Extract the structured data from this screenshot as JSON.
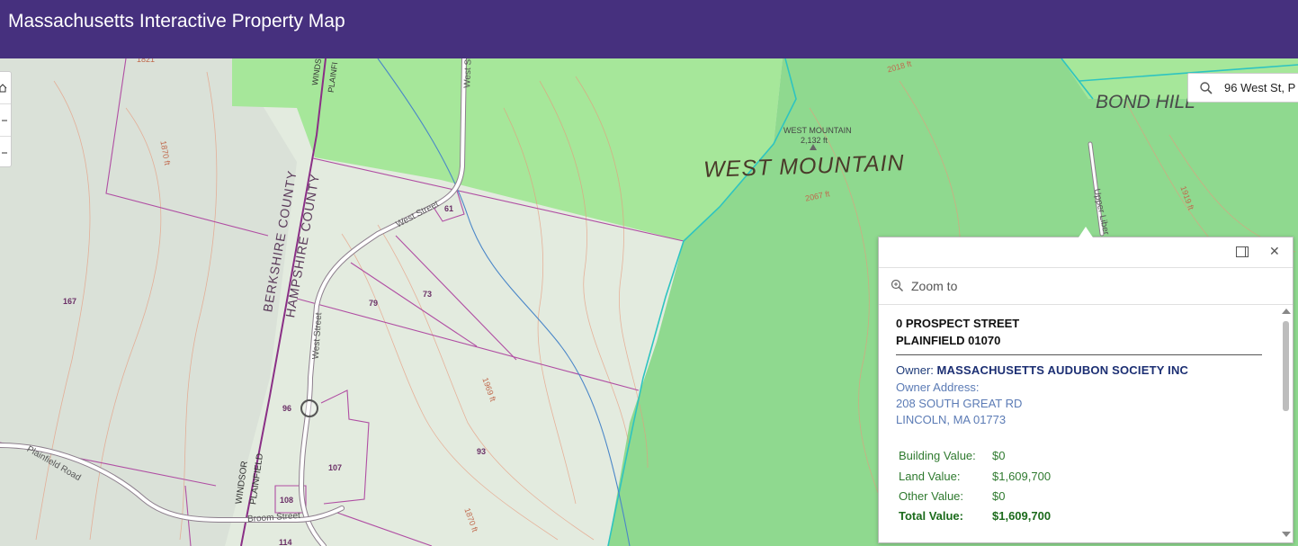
{
  "header": {
    "title": "Massachusetts Interactive Property Map"
  },
  "search": {
    "value": "96 West St, P"
  },
  "colors": {
    "header": "#46307e",
    "forest": "#8fd98f",
    "parcel_line": "#b04ea3",
    "town_line": "#2ec4c0"
  },
  "map_labels": {
    "west_mountain": "WEST MOUNTAIN",
    "bond_hill": "BOND HILL",
    "summit_name": "WEST MOUNTAIN",
    "summit_elev": "2,132 ft",
    "berkshire": "BERKSHIRE COUNTY",
    "hampshire": "HAMPSHIRE COUNTY",
    "windsor_top": "WINDS",
    "plainfield_top": "PLAINFI",
    "windsor_bottom": "WINDSOR",
    "plainfield_bottom": "PLAINFIELD",
    "west_street_1": "West Street",
    "west_street_2": "West Street",
    "west_street_top": "West St",
    "plainfield_road": "Plainfield Road",
    "broom_street": "Broom Street",
    "upper_liberty": "Upper Liber",
    "elev_2018": "2018 ft",
    "elev_2067": "2067 ft",
    "elev_1969": "1969 ft",
    "elev_1870": "1870 ft",
    "elev_1919": "1919 ft",
    "elev_1870b": "1870 ft",
    "elev_1821": "1821"
  },
  "parcels": [
    "167",
    "61",
    "79",
    "73",
    "96",
    "107",
    "93",
    "108",
    "114"
  ],
  "popup": {
    "zoom_to": "Zoom to",
    "address_line1": "0 PROSPECT STREET",
    "address_line2": "PLAINFIELD 01070",
    "owner_label": "Owner:",
    "owner_name": "MASSACHUSETTS AUDUBON SOCIETY INC",
    "owner_address_label": "Owner Address:",
    "owner_address_1": "208 SOUTH GREAT RD",
    "owner_address_2": "LINCOLN, MA 01773",
    "values": [
      {
        "label": "Building Value:",
        "value": "$0"
      },
      {
        "label": "Land Value:",
        "value": "$1,609,700"
      },
      {
        "label": "Other Value:",
        "value": "$0"
      },
      {
        "label": "Total Value:",
        "value": "$1,609,700"
      }
    ]
  }
}
